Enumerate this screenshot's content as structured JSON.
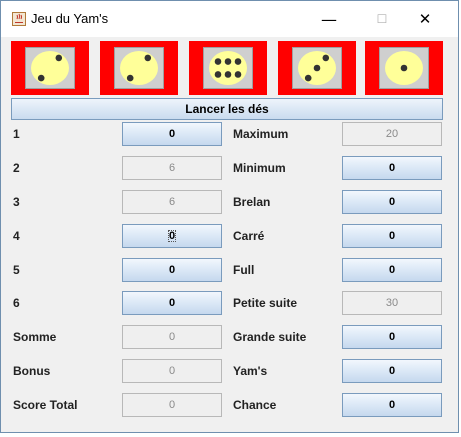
{
  "window": {
    "title": "Jeu du Yam's",
    "minimize": "—",
    "maximize": "☐",
    "close": "✕"
  },
  "dice": [
    2,
    2,
    6,
    3,
    1
  ],
  "colors": {
    "die_background": "#ff0000",
    "die_face": "#ffff99",
    "pip": "#333333"
  },
  "roll_button": "Lancer les dés",
  "left": [
    {
      "label": "1",
      "value": "0",
      "type": "button"
    },
    {
      "label": "2",
      "value": "6",
      "type": "field"
    },
    {
      "label": "3",
      "value": "6",
      "type": "field"
    },
    {
      "label": "4",
      "value": "0",
      "type": "button"
    },
    {
      "label": "5",
      "value": "0",
      "type": "button"
    },
    {
      "label": "6",
      "value": "0",
      "type": "button"
    },
    {
      "label": "Somme",
      "value": "0",
      "type": "field"
    },
    {
      "label": "Bonus",
      "value": "0",
      "type": "field"
    },
    {
      "label": "Score Total",
      "value": "0",
      "type": "field"
    }
  ],
  "right": [
    {
      "label": "Maximum",
      "value": "20",
      "type": "field"
    },
    {
      "label": "Minimum",
      "value": "0",
      "type": "button"
    },
    {
      "label": "Brelan",
      "value": "0",
      "type": "button"
    },
    {
      "label": "Carré",
      "value": "0",
      "type": "button"
    },
    {
      "label": "Full",
      "value": "0",
      "type": "button"
    },
    {
      "label": "Petite suite",
      "value": "30",
      "type": "field"
    },
    {
      "label": "Grande suite",
      "value": "0",
      "type": "button"
    },
    {
      "label": "Yam's",
      "value": "0",
      "type": "button"
    },
    {
      "label": "Chance",
      "value": "0",
      "type": "button"
    }
  ]
}
